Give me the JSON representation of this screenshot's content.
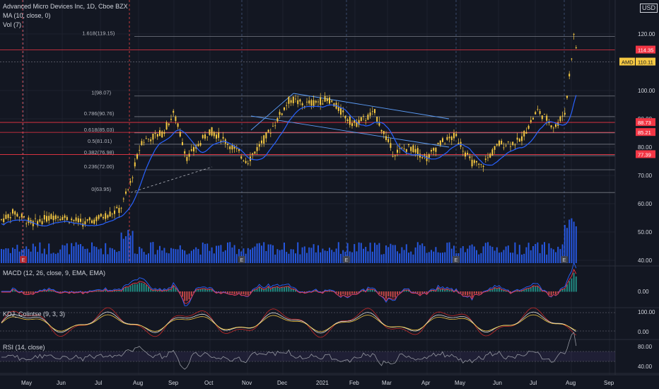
{
  "header": {
    "symbol_line": "Advanced Micro Devices Inc, 1D, Cboe BZX",
    "ma_line": "MA (10, close, 0)",
    "vol_line": "Vol (7)",
    "currency": "USD"
  },
  "price_axis": {
    "ticks": [
      "120.00",
      "100.00",
      "90.00",
      "80.00",
      "70.00",
      "60.00",
      "50.00",
      "40.00"
    ],
    "tick_values": [
      120,
      100,
      90,
      80,
      70,
      60,
      50,
      40
    ]
  },
  "price_badges": [
    {
      "label": "114.35",
      "value": 114.35,
      "color": "#f23645"
    },
    {
      "label": "110.11",
      "value": 110.11,
      "color": "#f5c842",
      "tag": "AMD"
    },
    {
      "label": "88.73",
      "value": 88.73,
      "color": "#f23645"
    },
    {
      "label": "85.21",
      "value": 85.21,
      "color": "#f23645"
    },
    {
      "label": "77.39",
      "value": 77.39,
      "color": "#f23645"
    }
  ],
  "fib_levels": [
    {
      "label": "1.618(119.15)",
      "value": 119.15
    },
    {
      "label": "1(98.07)",
      "value": 98.07
    },
    {
      "label": "0.786(90.76)",
      "value": 90.76
    },
    {
      "label": "0.618(85.03)",
      "value": 85.03
    },
    {
      "label": "0.5(81.01)",
      "value": 81.01
    },
    {
      "label": "0.382(76.98)",
      "value": 76.98
    },
    {
      "label": "0.236(72.00)",
      "value": 72.0
    },
    {
      "label": "0(63.95)",
      "value": 63.95
    }
  ],
  "time_axis": {
    "labels": [
      "May",
      "Jun",
      "Jul",
      "Aug",
      "Sep",
      "Oct",
      "Nov",
      "Dec",
      "2021",
      "Feb",
      "Mar",
      "Apr",
      "May",
      "Jun",
      "Jul",
      "Aug",
      "Sep"
    ]
  },
  "earnings_marker": "E",
  "macd": {
    "title": "MACD (12, 26, close, 9, EMA, EMA)",
    "tick": "0.00"
  },
  "stoch": {
    "title": "KDJ_Colintse (9, 3, 3)",
    "ticks": [
      "100.00",
      "0.00"
    ]
  },
  "rsi": {
    "title": "RSI (14, close)",
    "ticks": [
      "80.00",
      "40.00"
    ]
  },
  "colors": {
    "background": "#131722",
    "candle": "#f5c842",
    "ma": "#2962ff",
    "volume": "#2962ff",
    "macd_line": "#2962ff",
    "signal_line": "#f23645",
    "resistance": "#f23645",
    "fib": "#787b86",
    "rsi": "#9598a1"
  }
}
